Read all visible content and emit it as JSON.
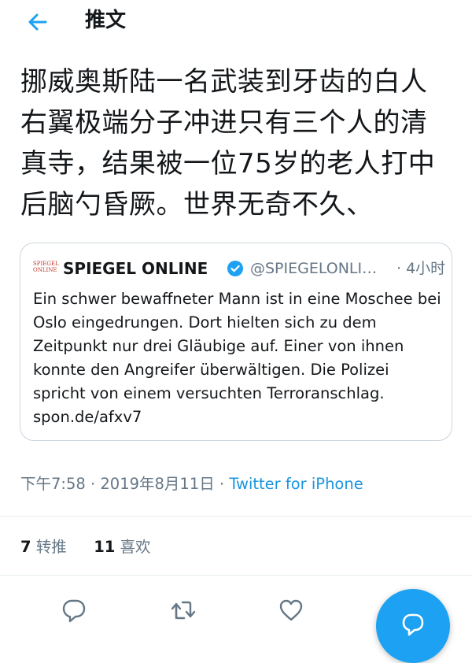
{
  "header": {
    "title": "推文"
  },
  "tweet": {
    "text": "挪威奥斯陆一名武装到牙齿的白人右翼极端分子冲进只有三个人的清真寺，结果被一位75岁的老人打中后脑勺昏厥。世界无奇不久、"
  },
  "quote": {
    "logo_line1": "SPIEGEL",
    "logo_line2": "ONLINE",
    "name": "SPIEGEL ONLINE",
    "handle": "@SPIEGELONLI…",
    "time": "· 4小时",
    "body": "Ein schwer bewaffneter Mann ist in eine Moschee bei Oslo eingedrungen. Dort hielten sich zu dem Zeitpunkt nur drei Gläubige auf. Einer von ihnen konnte den Angreifer überwältigen. Die Polizei spricht von einem versuchten Terroranschlag. spon.de/afxv7"
  },
  "meta": {
    "datetime": "下午7:58 · 2019年8月11日 · ",
    "source": "Twitter for iPhone"
  },
  "stats": {
    "retweets_count": "7",
    "retweets_label": "转推",
    "likes_count": "11",
    "likes_label": "喜欢"
  },
  "icons": {
    "back": "arrow-left-icon",
    "verified": "verified-badge-icon",
    "reply": "reply-icon",
    "retweet": "retweet-icon",
    "like": "heart-icon",
    "compose": "compose-reply-icon"
  },
  "colors": {
    "accent": "#1da1f2",
    "link": "#1b95e0",
    "secondary_text": "#657786",
    "primary_text": "#14171a",
    "border": "#ccd6dd"
  }
}
